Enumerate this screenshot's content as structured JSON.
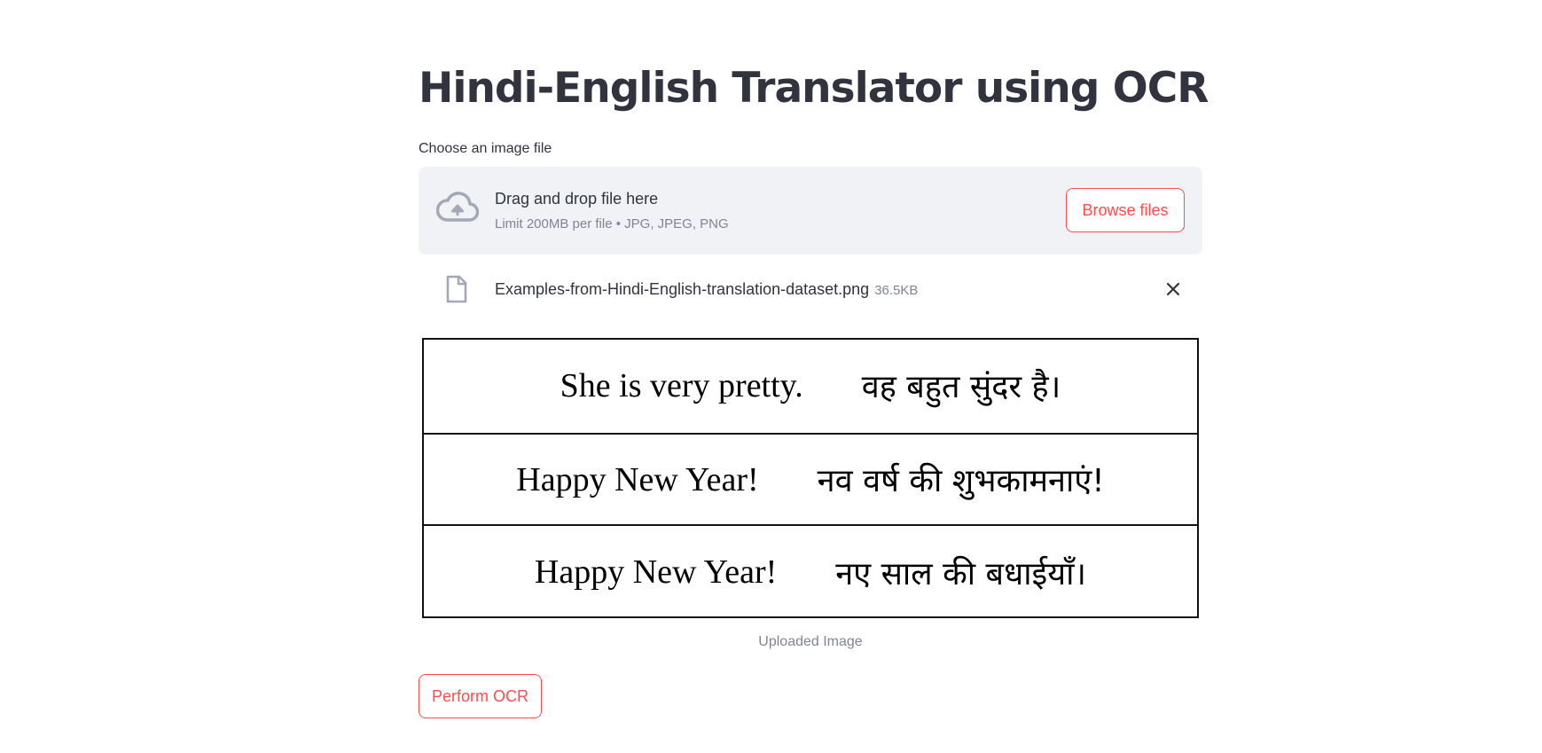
{
  "page": {
    "title": "Hindi-English Translator using OCR"
  },
  "uploader": {
    "label": "Choose an image file",
    "dropzone_title": "Drag and drop file here",
    "dropzone_limit": "Limit 200MB per file • JPG, JPEG, PNG",
    "browse_label": "Browse files",
    "icon": "cloud-upload-icon"
  },
  "uploaded_file": {
    "name": "Examples-from-Hindi-English-translation-dataset.png",
    "size": "36.5KB",
    "icon": "file-icon",
    "remove_icon": "close-icon"
  },
  "image_preview": {
    "rows": [
      {
        "english": "She is very pretty.",
        "hindi": "वह बहुत सुंदर है।"
      },
      {
        "english": "Happy New Year!",
        "hindi": "नव वर्ष की शुभकामनाएं!"
      },
      {
        "english": "Happy New Year!",
        "hindi": "नए साल की बधाईयाँ।"
      }
    ],
    "caption": "Uploaded Image"
  },
  "actions": {
    "ocr_label": "Perform OCR"
  },
  "colors": {
    "accent": "#ff4b4b",
    "text": "#31333f",
    "muted": "#808495",
    "dropzone_bg": "#f0f2f6",
    "icon": "#a3a8b8"
  }
}
